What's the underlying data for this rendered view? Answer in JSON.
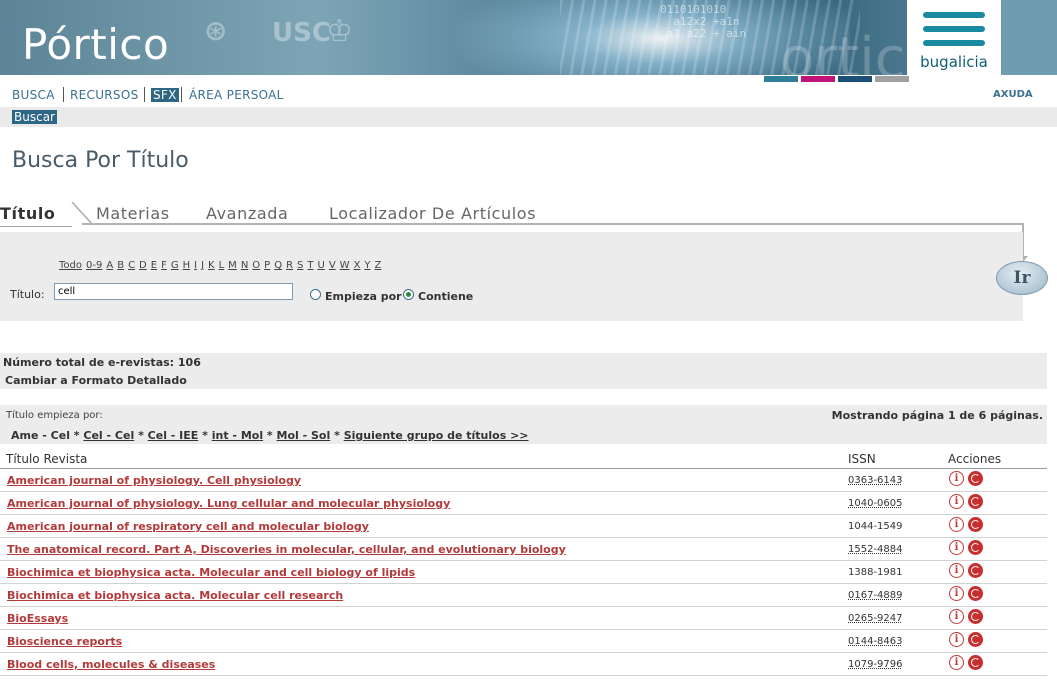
{
  "banner": {
    "logo": "Pórtico",
    "emblems": [
      "⊛",
      "USC",
      "♔"
    ],
    "brand": "bugalicia",
    "binary_text": "0110101010\n  a12x2 +a1n\n a1 a22 + ain",
    "bg_word": "ortico",
    "colors": [
      "#2f7f9a",
      "#c0147a",
      "#1a4f7a",
      "#a0a0a0"
    ]
  },
  "nav": {
    "items": [
      "BUSCA",
      "RECURSOS",
      "SFX",
      "ÁREA PERSOAL"
    ],
    "help": "AXUDA",
    "sub": "Buscar"
  },
  "page_title": "Busca Por Título",
  "tabs": [
    "Título",
    "Materias",
    "Avanzada",
    "Localizador De Artículos"
  ],
  "search": {
    "letters": [
      "Todo",
      "0-9",
      "A",
      "B",
      "C",
      "D",
      "E",
      "F",
      "G",
      "H",
      "I",
      "J",
      "K",
      "L",
      "M",
      "N",
      "O",
      "P",
      "Q",
      "R",
      "S",
      "T",
      "U",
      "V",
      "W",
      "X",
      "Y",
      "Z"
    ],
    "label": "Título:",
    "value": "cell",
    "opt_starts": "Empieza por",
    "opt_contains": "Contiene",
    "selected": "Contiene",
    "go": "Ir"
  },
  "results": {
    "total": "Número total de e-revistas: 106",
    "format_link": "Cambiar a Formato Detallado",
    "range_label": "Título empieza por:",
    "page_info": "Mostrando página 1 de 6 páginas.",
    "range_current": "Ame - Cel",
    "ranges": [
      "Cel - Cel",
      "Cel - IEE",
      "int - Mol",
      "Mol - Sol"
    ],
    "next_group": "Siguiente grupo de títulos >>",
    "columns": [
      "Título Revista",
      "ISSN",
      "Acciones"
    ],
    "rows": [
      {
        "title": "American journal of physiology. Cell physiology",
        "issn": "0363-6143",
        "dotted": true
      },
      {
        "title": "American journal of physiology. Lung cellular and molecular physiology",
        "issn": "1040-0605",
        "dotted": true
      },
      {
        "title": "American journal of respiratory cell and molecular biology",
        "issn": "1044-1549",
        "dotted": false
      },
      {
        "title": "The anatomical record. Part A, Discoveries in molecular, cellular, and evolutionary biology",
        "issn": "1552-4884",
        "dotted": true
      },
      {
        "title": "Biochimica et biophysica acta. Molecular and cell biology of lipids",
        "issn": "1388-1981",
        "dotted": false
      },
      {
        "title": "Biochimica et biophysica acta. Molecular cell research",
        "issn": "0167-4889",
        "dotted": true
      },
      {
        "title": "BioEssays",
        "issn": "0265-9247",
        "dotted": true
      },
      {
        "title": "Bioscience reports",
        "issn": "0144-8463",
        "dotted": true
      },
      {
        "title": "Blood cells, molecules & diseases",
        "issn": "1079-9796",
        "dotted": true
      }
    ]
  },
  "icons": {
    "info": "info-icon",
    "sfx": "sfx-icon",
    "info_glyph": "i"
  }
}
